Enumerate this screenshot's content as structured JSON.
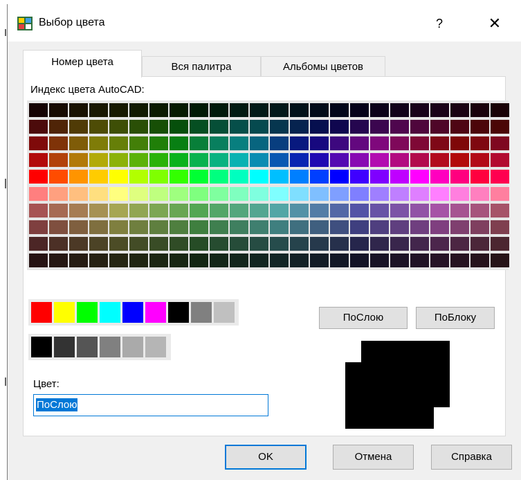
{
  "window": {
    "title": "Выбор цвета",
    "help_label": "?",
    "close_label": "✕"
  },
  "tabs": [
    {
      "label": "Номер цвета",
      "active": true
    },
    {
      "label": "Вся палитра",
      "active": false
    },
    {
      "label": "Альбомы цветов",
      "active": false
    }
  ],
  "aci": {
    "label": "Индекс цвета AutoCAD:",
    "upper_rows": [
      [
        "#150303",
        "#180b02",
        "#1a1202",
        "#1a1802",
        "#181a02",
        "#121a02",
        "#0c1a02",
        "#061a02",
        "#021a05",
        "#021a0c",
        "#021a12",
        "#021a18",
        "#02181a",
        "#02121a",
        "#020c1a",
        "#02061a",
        "#05021a",
        "#0c021a",
        "#12021a",
        "#18021a",
        "#1a0218",
        "#1a0212",
        "#1a020c",
        "#1a0206"
      ],
      [
        "#4c0b0b",
        "#4f2407",
        "#503b06",
        "#4e4c06",
        "#3e4f06",
        "#2a4f06",
        "#174f06",
        "#064f0b",
        "#064f22",
        "#064f37",
        "#064f4a",
        "#064a4f",
        "#06364f",
        "#06234f",
        "#060f4f",
        "#0f064f",
        "#25064f",
        "#3b064f",
        "#4f064e",
        "#4f063c",
        "#4f0628",
        "#4f0614",
        "#4c060a",
        "#4b0606"
      ],
      [
        "#7f0a0a",
        "#7f3308",
        "#7f5c08",
        "#7f7c08",
        "#667f08",
        "#437f08",
        "#207f08",
        "#087f13",
        "#087f39",
        "#087f5e",
        "#087f7f",
        "#08657f",
        "#083e7f",
        "#08197f",
        "#17087f",
        "#3d087f",
        "#63087f",
        "#7f087c",
        "#7f085a",
        "#7f0836",
        "#7f0817",
        "#7f0808",
        "#7f0810",
        "#7f0820"
      ],
      [
        "#b20a0a",
        "#b2420a",
        "#b27a0a",
        "#b2aa0a",
        "#8cb20a",
        "#5cb20a",
        "#2bb20a",
        "#0ab21d",
        "#0ab24f",
        "#0ab281",
        "#0ab2b2",
        "#0a8cb2",
        "#0a58b2",
        "#0a25b2",
        "#200ab2",
        "#540ab2",
        "#880ab2",
        "#b20ab0",
        "#b20a80",
        "#b20a4c",
        "#b20a1e",
        "#b20a0a",
        "#b20a18",
        "#b20a30"
      ],
      [
        "#ff0000",
        "#ff4c00",
        "#ff9400",
        "#ffcc00",
        "#ffff00",
        "#b2ff00",
        "#7fff00",
        "#33ff00",
        "#00ff33",
        "#00ff7f",
        "#00ffbf",
        "#00ffff",
        "#00bfff",
        "#007fff",
        "#003fff",
        "#0000ff",
        "#3f00ff",
        "#7f00ff",
        "#bf00ff",
        "#ff00ff",
        "#ff00bf",
        "#ff007f",
        "#ff003f",
        "#ff0050"
      ]
    ],
    "lower_rows": [
      [
        "#ff7f7f",
        "#ffa07f",
        "#ffbf7f",
        "#ffdf7f",
        "#ffff7f",
        "#dfff7f",
        "#bfff7f",
        "#9fff7f",
        "#7fff7f",
        "#7fff9f",
        "#7fffbf",
        "#7fffdf",
        "#7fffff",
        "#7fdfff",
        "#7fbfff",
        "#7f9fff",
        "#7f7fff",
        "#9f7fff",
        "#bf7fff",
        "#df7fff",
        "#ff7fff",
        "#ff7fdf",
        "#ff7fbf",
        "#ff7f9f"
      ],
      [
        "#a65353",
        "#a66a53",
        "#a67c53",
        "#a69153",
        "#a6a653",
        "#91a653",
        "#7ca653",
        "#68a653",
        "#53a653",
        "#53a668",
        "#53a67c",
        "#53a691",
        "#53a6a6",
        "#5391a6",
        "#537ca6",
        "#5368a6",
        "#5353a6",
        "#6853a6",
        "#7c53a6",
        "#9153a6",
        "#a653a6",
        "#a65391",
        "#a6537c",
        "#a65368"
      ],
      [
        "#7f3f3f",
        "#7f4f3f",
        "#7f5f3f",
        "#7f6f3f",
        "#7f7f3f",
        "#6f7f3f",
        "#5f7f3f",
        "#4f7f3f",
        "#3f7f3f",
        "#3f7f4f",
        "#3f7f5f",
        "#3f7f6f",
        "#3f7f7f",
        "#3f6f7f",
        "#3f5f7f",
        "#3f4f7f",
        "#3f3f7f",
        "#4f3f7f",
        "#5f3f7f",
        "#6f3f7f",
        "#7f3f7f",
        "#7f3f6f",
        "#7f3f5f",
        "#7f3f4f"
      ],
      [
        "#4c2626",
        "#4c3026",
        "#4c3926",
        "#4c4326",
        "#4c4c26",
        "#434c26",
        "#394c26",
        "#304c26",
        "#264c26",
        "#264c30",
        "#264c39",
        "#264c43",
        "#264c4c",
        "#26434c",
        "#26394c",
        "#26304c",
        "#26264c",
        "#30264c",
        "#39264c",
        "#43264c",
        "#4c264c",
        "#4c2643",
        "#4c2639",
        "#4c2630"
      ],
      [
        "#261313",
        "#261813",
        "#261c13",
        "#262113",
        "#262613",
        "#212613",
        "#1c2613",
        "#182613",
        "#132613",
        "#132618",
        "#13261c",
        "#132621",
        "#132626",
        "#132126",
        "#131c26",
        "#131826",
        "#131326",
        "#181326",
        "#1c1326",
        "#211326",
        "#261326",
        "#261321",
        "#26131c",
        "#261318"
      ]
    ]
  },
  "standard_colors": [
    "#ff0000",
    "#ffff00",
    "#00ff00",
    "#00ffff",
    "#0000ff",
    "#ff00ff",
    "#000000",
    "#808080",
    "#c0c0c0"
  ],
  "gray_colors": [
    "#000000",
    "#333333",
    "#555555",
    "#808080",
    "#aaaaaa",
    "#b5b5b5"
  ],
  "buttons": {
    "bylayer": "ПоСлою",
    "byblock": "ПоБлоку"
  },
  "color": {
    "label": "Цвет:",
    "value": "ПоСлою"
  },
  "preview": {
    "old_color": "#000000",
    "new_color": "#000000"
  },
  "footer": {
    "ok": "OK",
    "cancel": "Отмена",
    "help": "Справка"
  }
}
